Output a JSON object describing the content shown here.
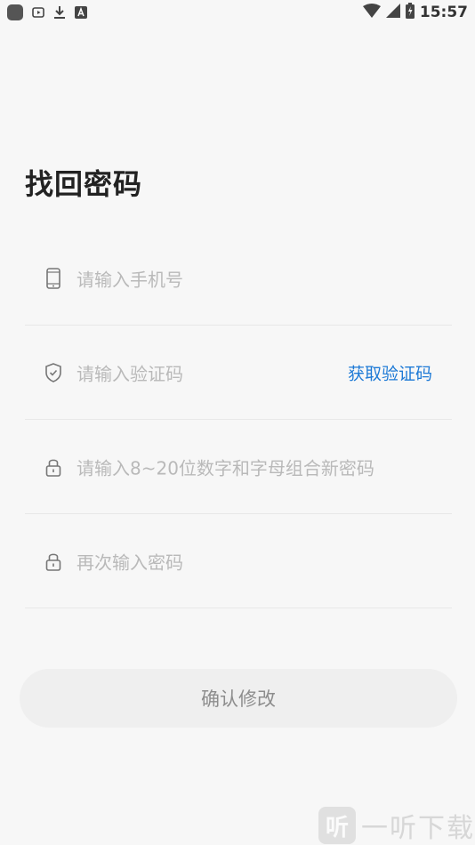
{
  "status_bar": {
    "time": "15:57",
    "left_icons": [
      "app-icon",
      "play-icon",
      "download-icon",
      "font-icon"
    ],
    "right_icons": [
      "wifi-icon",
      "signal-icon",
      "battery-charging-icon"
    ]
  },
  "page": {
    "title": "找回密码"
  },
  "form": {
    "phone": {
      "placeholder": "请输入手机号",
      "icon": "phone-icon"
    },
    "code": {
      "placeholder": "请输入验证码",
      "icon": "shield-icon",
      "action": "获取验证码"
    },
    "new_password": {
      "placeholder": "请输入8~20位数字和字母组合新密码",
      "icon": "lock-icon"
    },
    "confirm_password": {
      "placeholder": "再次输入密码",
      "icon": "lock-icon"
    }
  },
  "submit": {
    "label": "确认修改"
  },
  "watermark": {
    "logo_char": "听",
    "text": "一听下载"
  },
  "colors": {
    "accent": "#1e7ad6",
    "placeholder": "#b9b9b9",
    "button_bg": "#efefef"
  }
}
